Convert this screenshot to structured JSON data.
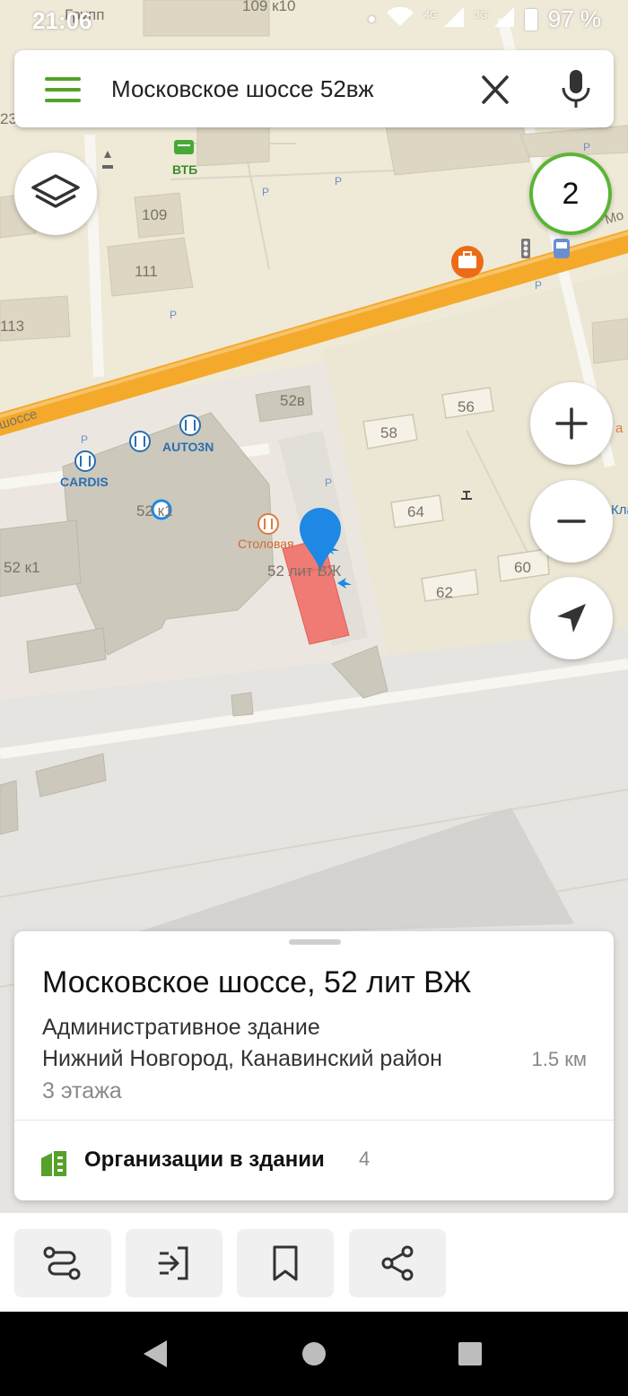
{
  "status": {
    "time": "21:06",
    "net_4g": "4G",
    "net_3g": "3G",
    "battery": "97 %"
  },
  "search": {
    "query": "Московское шоссе 52вж"
  },
  "traffic": {
    "level": "2"
  },
  "map_labels": {
    "top_road": "109 к10",
    "group": "Групп",
    "vtb": "ВТБ",
    "b109": "109",
    "b111": "111",
    "b113": "113",
    "b23": "23",
    "road_left": "шоссе",
    "road_right": "Мо",
    "b52v": "52в",
    "b56": "56",
    "b58": "58",
    "b64": "64",
    "b60": "60",
    "b62": "62",
    "autozn": "AUTO3N",
    "cardis": "CARDIS",
    "b52k1": "52 к1",
    "b52k1b": "52 к1",
    "stolovaya": "Столовая",
    "b52litvzh": "52 лит ВЖ",
    "kla": "Кла",
    "right_a": "а",
    "parking": "P"
  },
  "card": {
    "title": "Московское шоссе, 52 лит ВЖ",
    "type": "Административное здание",
    "address": "Нижний Новгород, Канавинский район",
    "distance": "1.5 км",
    "floors": "3 этажа",
    "orgs_label": "Организации в здании",
    "orgs_count": "4"
  },
  "colors": {
    "brand_green": "#55a12a",
    "road_orange": "#f5a623",
    "selected_building": "#f07b75",
    "pin_blue": "#1e88e5",
    "poi_orange": "#ec6b16",
    "poi_label": "#2a6fb0"
  },
  "icons": {
    "menu": "hamburger-icon",
    "clear": "close-icon",
    "voice": "microphone-icon",
    "layers": "layers-icon",
    "zoom_in": "plus-icon",
    "zoom_out": "minus-icon",
    "locate": "navigation-arrow-icon",
    "route": "route-icon",
    "exit": "enter-icon",
    "bookmark": "bookmark-icon",
    "share": "share-icon"
  }
}
